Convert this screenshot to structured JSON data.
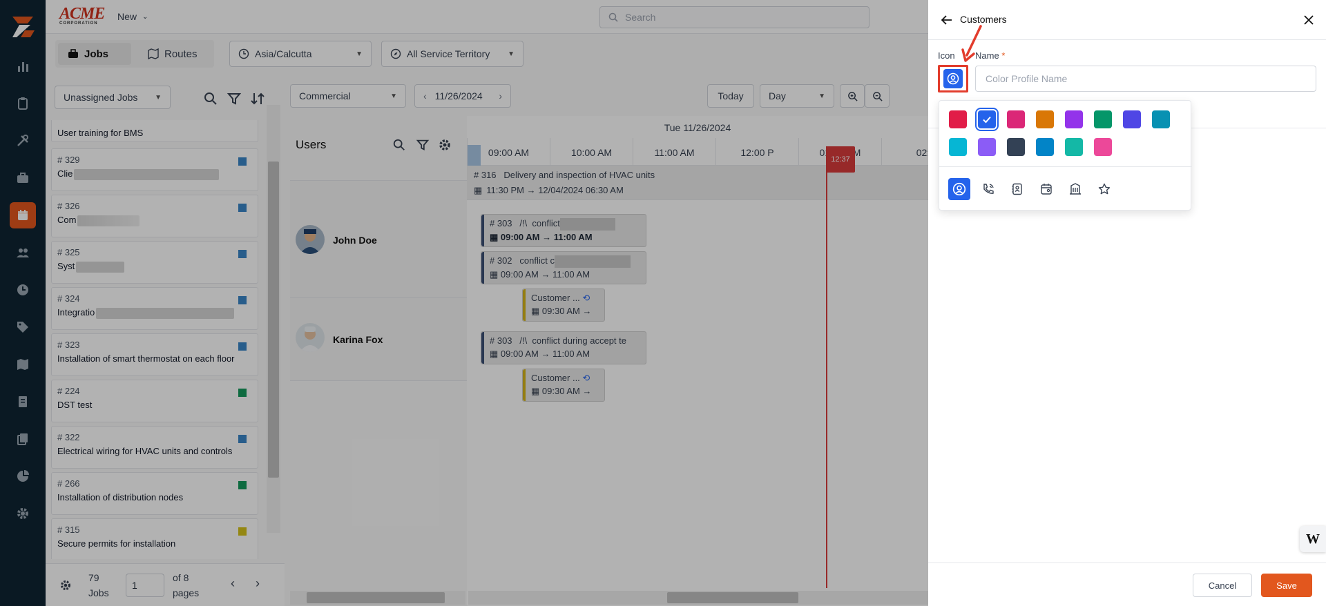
{
  "app": {
    "brand_top": "ACME",
    "brand_bottom": "CORPORATION",
    "new_label": "New",
    "search_placeholder": "Search"
  },
  "toolbar": {
    "jobs_tab": "Jobs",
    "routes_tab": "Routes",
    "timezone": "Asia/Calcutta",
    "territory": "All Service Territory"
  },
  "left_panel": {
    "filter": "Unassigned Jobs",
    "jobs": [
      {
        "num": "",
        "desc": "User training for BMS",
        "color": ""
      },
      {
        "num": "# 329",
        "desc": "Clie",
        "color": "#3a86c8"
      },
      {
        "num": "# 326",
        "desc": "Com",
        "color": "#3a86c8"
      },
      {
        "num": "# 325",
        "desc": "Syst",
        "color": "#3a86c8"
      },
      {
        "num": "# 324",
        "desc": "Integratio",
        "color": "#3a86c8"
      },
      {
        "num": "# 323",
        "desc": "Installation of smart thermostat on each floor",
        "color": "#3a86c8"
      },
      {
        "num": "# 224",
        "desc": "DST test",
        "color": "#159a5c"
      },
      {
        "num": "# 322",
        "desc": "Electrical wiring for HVAC units and controls",
        "color": "#3a86c8"
      },
      {
        "num": "# 266",
        "desc": "Installation of distribution nodes",
        "color": "#159a5c"
      },
      {
        "num": "# 315",
        "desc": "Secure permits for installation",
        "color": "#d4c21a"
      }
    ],
    "count": "79",
    "count_label": "Jobs",
    "page": "1",
    "of_pages": "of 8",
    "pages_label": "pages"
  },
  "schedule": {
    "view": "Commercial",
    "date": "11/26/2024",
    "today": "Today",
    "range": "Day",
    "users_label": "Users",
    "header_date": "Tue 11/26/2024",
    "hours": [
      "09:00 AM",
      "10:00 AM",
      "11:00 AM",
      "12:00 P",
      "01:00 PM",
      "02:"
    ],
    "now": "12:37",
    "users": [
      {
        "name": "John Doe"
      },
      {
        "name": "Karina Fox"
      }
    ],
    "events": {
      "e316_title": "# 316   Delivery and inspection of HVAC units",
      "e316_time": "11:30 PM → 12/04/2024 06:30 AM",
      "e303a_title": "# 303   /!\\  conflict",
      "e303a_time": "09:00 AM → 11:00 AM",
      "e302_title": "# 302   conflict c",
      "e302_time": "09:00 AM → 11:00 AM",
      "cust1_title": "Customer ...",
      "cust1_time": "09:30 AM →",
      "e303b_title": "# 303   /!\\  conflict during accept te",
      "e303b_time": "09:00 AM → 11:00 AM",
      "cust2_title": "Customer ...",
      "cust2_time": "09:30 AM →"
    }
  },
  "drawer": {
    "title": "Customers",
    "icon_label": "Icon",
    "name_label": "Name",
    "required_mark": "*",
    "name_placeholder": "Color Profile Name",
    "name_value": "",
    "colors": [
      "#e11d48",
      "#2563eb",
      "#db2777",
      "#d97706",
      "#9333ea",
      "#059669",
      "#4f46e5",
      "#0891b2",
      "#06b6d4",
      "#8b5cf6",
      "#334155",
      "#0284c7",
      "#14b8a6",
      "#ec4899"
    ],
    "selected_color": "#2563eb",
    "icons": [
      "user-circle-icon",
      "phone-call-icon",
      "address-book-icon",
      "calendar-user-icon",
      "building-icon",
      "star-icon"
    ],
    "selected_icon": "user-circle-icon",
    "cancel": "Cancel",
    "save": "Save",
    "badge": "W"
  }
}
